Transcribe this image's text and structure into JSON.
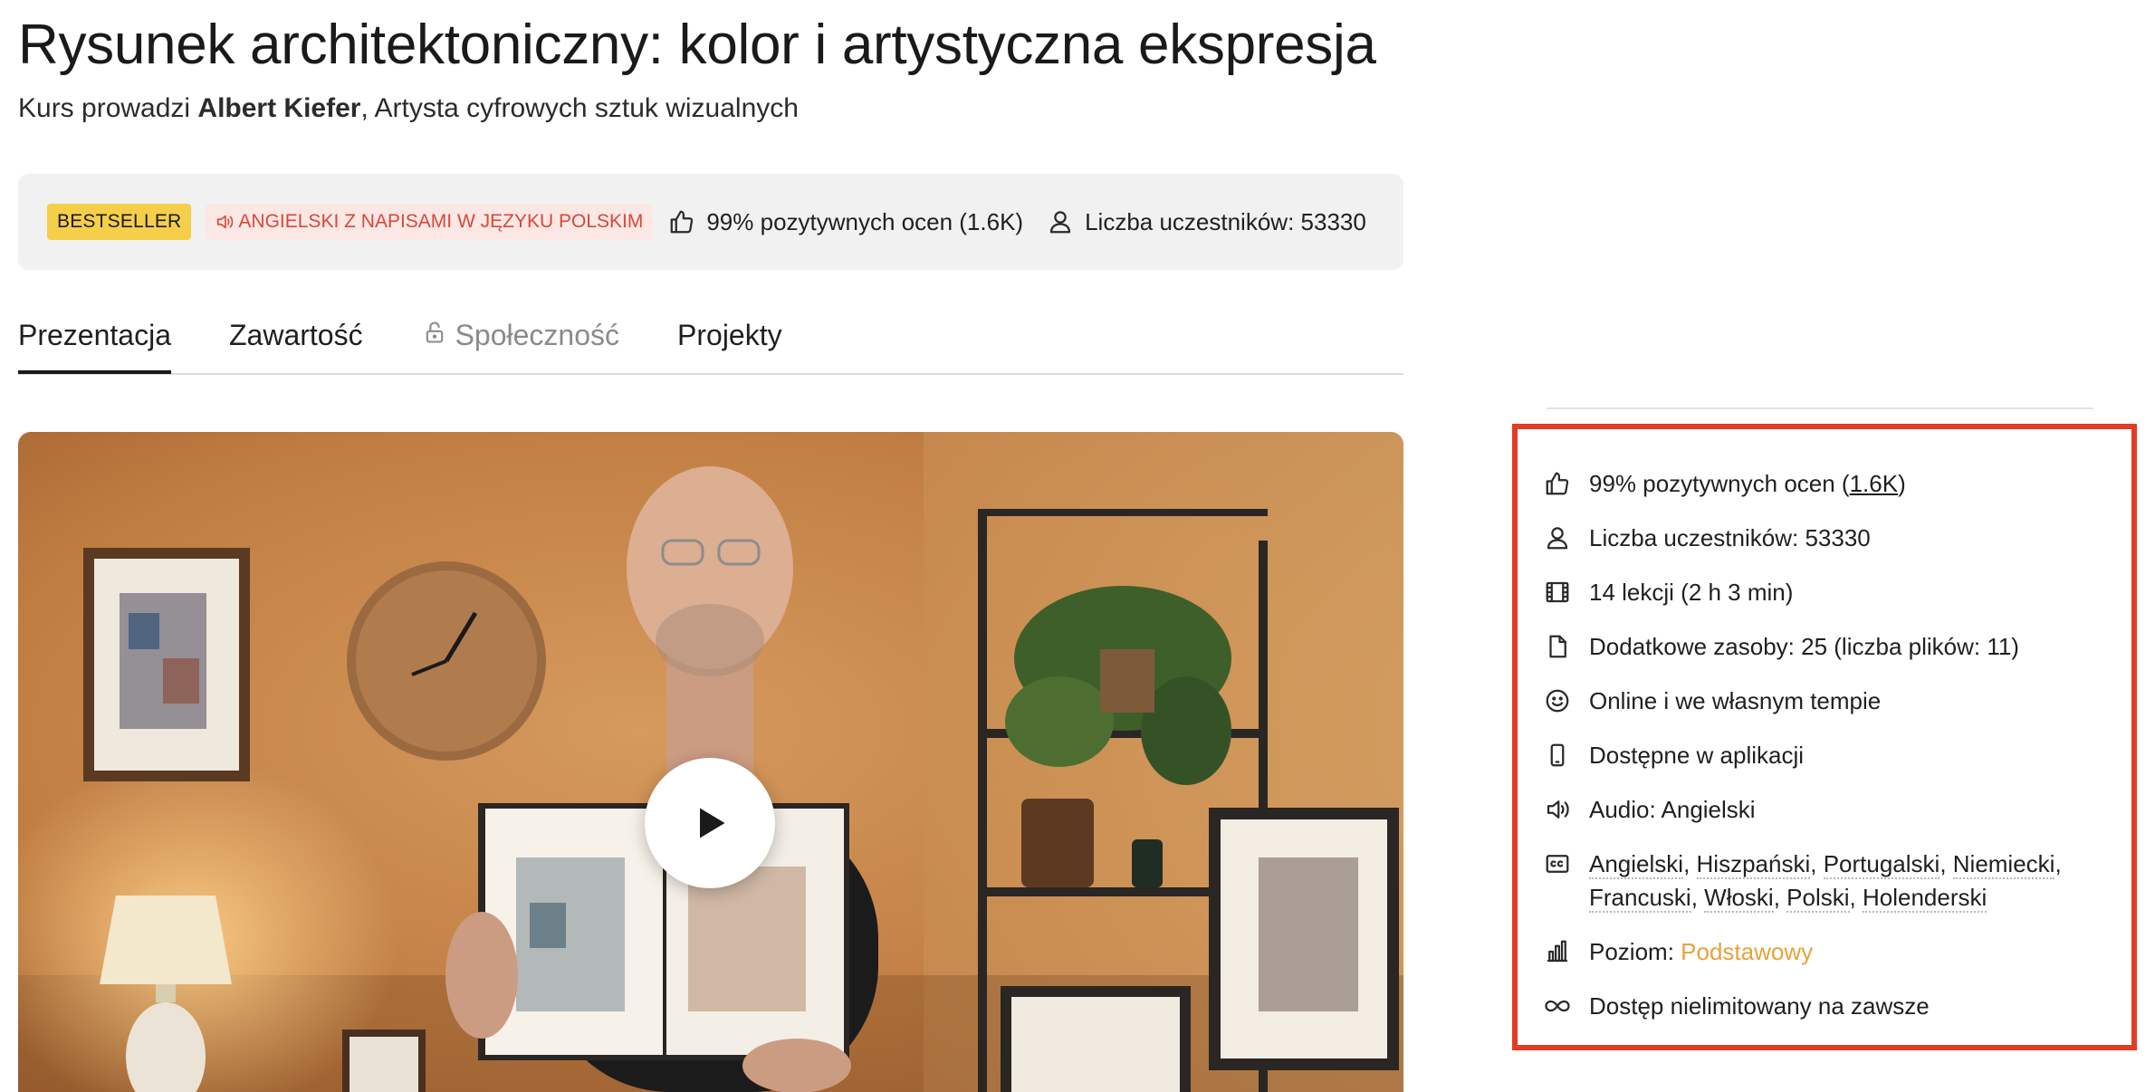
{
  "course": {
    "title": "Rysunek architektoniczny: kolor i artystyczna ekspresja",
    "subtitle_prefix": "Kurs prowadzi",
    "instructor": "Albert Kiefer",
    "instructor_role": ", Artysta cyfrowych sztuk wizualnych"
  },
  "info_bar": {
    "badge_bestseller": "BESTSELLER",
    "badge_language": "ANGIELSKI Z NAPISAMI W JĘZYKU POLSKIM",
    "rating": "99% pozytywnych ocen (1.6K)",
    "students": "Liczba uczestników: 53330"
  },
  "tabs": [
    {
      "label": "Prezentacja",
      "active": true
    },
    {
      "label": "Zawartość"
    },
    {
      "label": "Społeczność",
      "locked": true
    },
    {
      "label": "Projekty"
    }
  ],
  "features": {
    "rating_text": "99% pozytywnych ocen (",
    "rating_count": "1.6K",
    "rating_close": ")",
    "students": "Liczba uczestników: 53330",
    "lessons": "14 lekcji (2 h 3 min)",
    "resources": "Dodatkowe zasoby: 25 (liczba plików: 11)",
    "pace": "Online i we własnym tempie",
    "app": "Dostępne w aplikacji",
    "audio": "Audio: Angielski",
    "subtitles": [
      "Angielski",
      "Hiszpański",
      "Portugalski",
      "Niemiecki",
      "Francuski",
      "Włoski",
      "Polski",
      "Holenderski"
    ],
    "level_label": "Poziom: ",
    "level_value": "Podstawowy",
    "access": "Dostęp nielimitowany na zawsze"
  },
  "colors": {
    "bestseller": "#f5cf49",
    "language_badge": "#d8483a",
    "level": "#e8a23a",
    "highlight": "#e23b26"
  }
}
